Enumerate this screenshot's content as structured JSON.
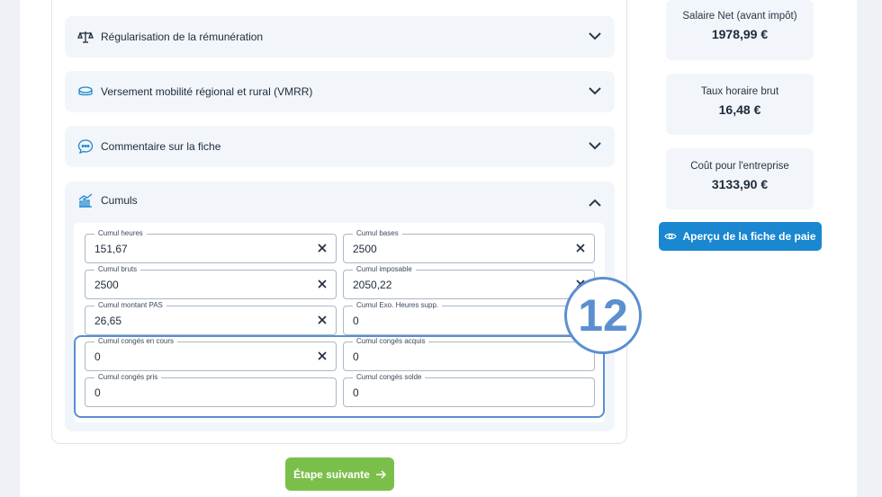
{
  "accordions": [
    {
      "title": "Régularisation de la rémunération",
      "icon": "scale-icon",
      "state": "collapsed"
    },
    {
      "title": "Versement mobilité régional et rural (VMRR)",
      "icon": "coins-icon",
      "state": "collapsed"
    },
    {
      "title": "Commentaire sur la fiche",
      "icon": "chat-icon",
      "state": "collapsed"
    },
    {
      "title": "Cumuls",
      "icon": "chart-icon",
      "state": "expanded"
    }
  ],
  "cumuls": {
    "fields": [
      {
        "label": "Cumul heures",
        "value": "151,67"
      },
      {
        "label": "Cumul bases",
        "value": "2500"
      },
      {
        "label": "Cumul bruts",
        "value": "2500"
      },
      {
        "label": "Cumul imposable",
        "value": "2050,22"
      },
      {
        "label": "Cumul montant PAS",
        "value": "26,65"
      },
      {
        "label": "Cumul Exo. Heures supp.",
        "value": "0"
      },
      {
        "label": "Cumul congés en cours",
        "value": "0"
      },
      {
        "label": "Cumul congés acquis",
        "value": "0"
      },
      {
        "label": "Cumul congés pris",
        "value": "0"
      },
      {
        "label": "Cumul congés solde",
        "value": "0"
      }
    ]
  },
  "annotation": {
    "step_number": "12",
    "color": "#5b8fd0"
  },
  "summary": [
    {
      "label": "Salaire Net (avant impôt)",
      "value": "1978,99 €"
    },
    {
      "label": "Taux horaire brut",
      "value": "16,48 €"
    },
    {
      "label": "Coût pour l'entreprise",
      "value": "3133,90 €"
    }
  ],
  "buttons": {
    "preview": "Aperçu de la fiche de paie",
    "next": "Étape suivante"
  },
  "colors": {
    "primary": "#1a87d0",
    "success": "#7bbf4b",
    "panel": "#f2f6fa"
  }
}
